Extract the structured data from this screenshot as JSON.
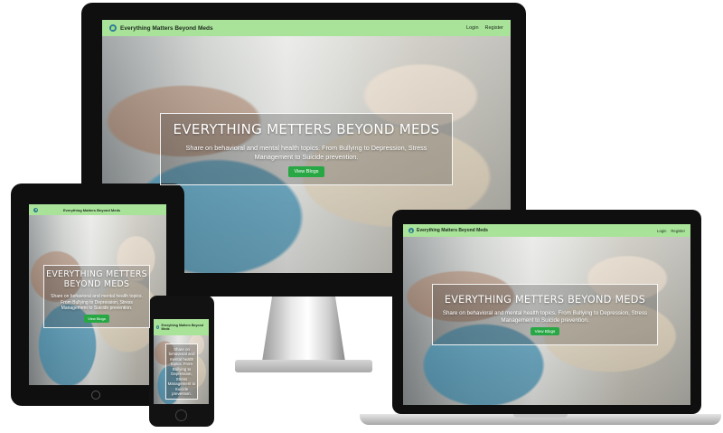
{
  "site": {
    "brand": "Everything Matters Beyond Meds",
    "nav": {
      "login": "Login",
      "register": "Register"
    },
    "hero": {
      "title": "EVERYTHING METTERS BEYOND MEDS",
      "description": "Share on behavioral and mental health topics. From Bullying to Depression, Stress Management to Suicide prevention.",
      "button": "View Blogs"
    }
  },
  "phone": {
    "description": "Share on behavioral and mental health topics. From Bullying to Depression, Stress Management to Suicide prevention."
  },
  "colors": {
    "nav_background": "#a9e39a",
    "button": "#28a745",
    "bezel": "#0f0f0f"
  },
  "icons": {
    "logo": "brain-leaf-icon"
  }
}
